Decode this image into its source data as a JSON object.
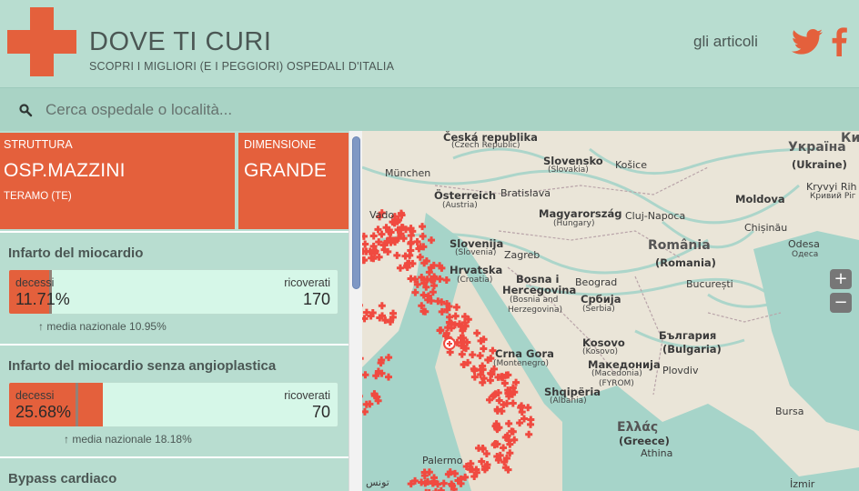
{
  "header": {
    "title": "DOVE TI CURI",
    "subtitle": "SCOPRI I MIGLIORI (E I PEGGIORI) OSPEDALI D'ITALIA",
    "nav_link": "gli articoli",
    "twitter_icon": "twitter-icon",
    "facebook_icon": "facebook-icon",
    "accent_color": "#e4603c"
  },
  "search": {
    "placeholder": "Cerca ospedale o località...",
    "value": "",
    "icon": "search-icon"
  },
  "hospital": {
    "struct_label": "STRUTTURA",
    "name": "OSP.MAZZINI",
    "city": "TERAMO (TE)",
    "size_label": "DIMENSIONE",
    "size": "GRANDE"
  },
  "indicators": [
    {
      "title": "Infarto del miocardio",
      "deaths_label": "decessi",
      "deaths_value": "11.71%",
      "deaths_fraction": 0.1171,
      "admitted_label": "ricoverati",
      "admitted_value": "170",
      "national_note": "↑ media nazionale 10.95%",
      "national_fraction": 0.1095
    },
    {
      "title": "Infarto del miocardio senza angioplastica",
      "deaths_label": "decessi",
      "deaths_value": "25.68%",
      "deaths_fraction": 0.2568,
      "admitted_label": "ricoverati",
      "admitted_value": "70",
      "national_note": "↑ media nazionale 18.18%",
      "national_fraction": 0.1818
    },
    {
      "title": "Bypass cardiaco"
    }
  ],
  "map": {
    "labels": {
      "czech": "Česká republika",
      "czech_en": "(Czech Republic)",
      "munchen": "München",
      "slovensko": "Slovensko",
      "slovakia": "(Slovakia)",
      "kosice": "Košice",
      "ukraina": "Україна",
      "ukraine": "(Ukraine)",
      "osterreich": "Österreich",
      "austria": "(Austria)",
      "bratislava": "Bratislava",
      "magyar": "Magyarország",
      "hungary": "(Hungary)",
      "cluj": "Cluj-Napoca",
      "moldova": "Moldova",
      "chisinau": "Chișinău",
      "kryvyi": "Kryvyi Rih",
      "kryvyi_cyr": "Кривий Ріг",
      "vado": "Vado",
      "slovenija": "Slovenija",
      "slovenia": "(Slovenia)",
      "zagreb": "Zagreb",
      "romania": "România",
      "romania_en": "(Romania)",
      "odesa": "Odesa",
      "odesa_cyr": "Одеса",
      "hrvatska": "Hrvatska",
      "croatia": "(Croatia)",
      "bosna": "Bosna i",
      "hercegovina": "Hercegovina",
      "bosnia_en": "(Bosnia and",
      "herzegovina_en": "Herzegovina)",
      "beograd": "Beograd",
      "srbija": "Србија",
      "serbia": "(Serbia)",
      "bucuresti": "București",
      "crna_gora": "Crna Gora",
      "montenegro": "(Montenegro)",
      "bulgaria": "България",
      "bulgaria_en": "(Bulgaria)",
      "kosovo": "Kosovo",
      "kosovo_en": "(Kosovo)",
      "makedonija": "Македонија",
      "macedonia": "(Macedonia)",
      "fyrom": "(FYROM)",
      "plovdiv": "Plovdiv",
      "shqiperia": "Shqipëria",
      "albania": "(Albania)",
      "ellas": "Ελλάς",
      "greece": "(Greece)",
      "bursa": "Bursa",
      "palermo": "Palermo",
      "athina": "Athina",
      "tunis": "تونس",
      "izmir": "İzmir",
      "kyiv_part": "Ки"
    },
    "zoom_in": "+",
    "zoom_out": "−",
    "marker_color": "#f04a40"
  }
}
